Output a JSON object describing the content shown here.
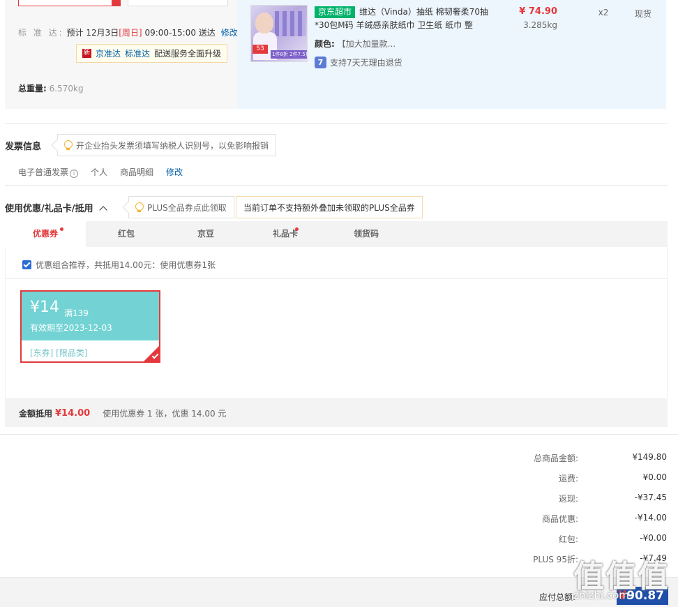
{
  "delivery": {
    "standard_label": "标 准 达:",
    "estimate_prefix": "预计 12月3日",
    "weekday": "[周日]",
    "time_window": "09:00-15:00 送达",
    "edit_label": "修改",
    "promo": {
      "new_badge": "新",
      "brand": "京准达",
      "standard": "标准达",
      "text": "配送服务全面升级"
    },
    "total_weight_label": "总重量:",
    "total_weight_value": "6.570kg"
  },
  "product": {
    "store_tag": "京东超市",
    "name": "维达（Vinda）抽纸 棉韧奢柔70抽*30包M码 羊绒感亲肤纸巾 卫生纸 纸巾 整",
    "color_label": "颜色:",
    "color_value": "【加大加量款...",
    "return_policy": "支持7天无理由退货",
    "return_icon": "7",
    "price": "¥ 74.90",
    "weight": "3.285kg",
    "qty": "x2",
    "stock": "现货",
    "image_badge": "53",
    "image_promo": "1件8折 2件7.5折"
  },
  "invoice": {
    "title": "发票信息",
    "tip": "开企业抬头发票须填写纳税人识别号，以免影响报销",
    "type": "电子普通发票",
    "info_icon": "i",
    "holder": "个人",
    "content": "商品明细",
    "edit_label": "修改"
  },
  "discounts": {
    "title": "使用优惠/礼品卡/抵用",
    "plus_tip": "PLUS全品券点此领取",
    "plus_warning": "当前订单不支持额外叠加未领取的PLUS全品券",
    "tabs": [
      {
        "label": "优惠券"
      },
      {
        "label": "红包"
      },
      {
        "label": "京豆"
      },
      {
        "label": "礼品卡"
      },
      {
        "label": "领货码"
      }
    ],
    "combo_text": "优惠组合推荐，共抵用14.00元：使用优惠券1张",
    "coupon": {
      "amount": "¥14",
      "condition": "满139",
      "expiry": "有效期至2023-12-03",
      "tags": "[东券] [限品类]"
    },
    "deduct_label": "金额抵用",
    "deduct_amount": "¥14.00",
    "deduct_note": "使用优惠券 1 张，优惠 14.00 元"
  },
  "summary": {
    "rows": [
      {
        "label": "总商品金额:",
        "value": "¥149.80"
      },
      {
        "label": "运费:",
        "value": "¥0.00"
      },
      {
        "label": "返现:",
        "value": "-¥37.45"
      },
      {
        "label": "商品优惠:",
        "value": "-¥14.00"
      },
      {
        "label": "红包:",
        "value": "-¥0.00"
      },
      {
        "label": "PLUS 95折:",
        "value": "-¥7.49"
      }
    ],
    "pay_label": "应付总额:",
    "pay_currency": "¥",
    "pay_amount": "90.87"
  },
  "watermark": {
    "chars": "值值值",
    "url": "zhizhi.com"
  },
  "colors": {
    "accent_red": "#e4393c",
    "link_blue": "#005ea7",
    "coupon_teal": "#73d3d4",
    "store_tag_green": "#00b26a"
  }
}
